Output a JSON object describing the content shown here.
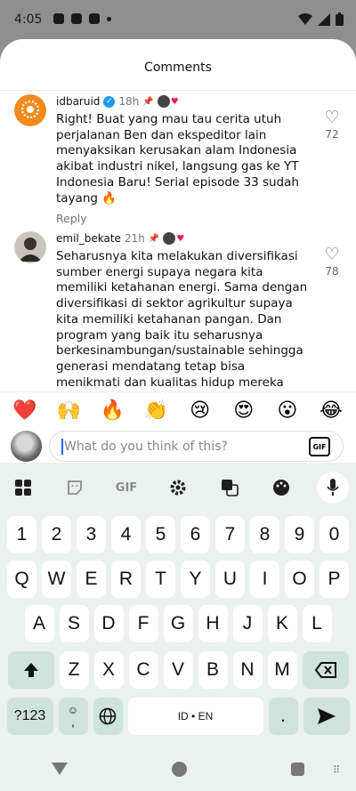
{
  "status": {
    "time": "4:05"
  },
  "sheet": {
    "title": "Comments"
  },
  "comments": [
    {
      "username": "idbaruid",
      "time": "18h",
      "text": "Right! Buat yang mau tau cerita utuh perjalanan Ben dan ekspeditor lain menyaksikan kerusakan alam Indonesia akibat industri nikel, langsung gas ke YT Indonesia Baru! Serial episode 33 sudah tayang 🔥",
      "reply": "Reply",
      "likes": "72"
    },
    {
      "username": "emil_bekate",
      "time": "21h",
      "text": "Seharusnya kita melakukan diversifikasi sumber energi supaya negara kita memiliki ketahanan energi. Sama dengan diversifikasi di sektor agrikultur supaya kita memiliki ketahanan pangan. Dan program yang baik itu seharusnya berkesinambungan/sustainable sehingga generasi mendatang tetap bisa menikmati dan kualitas hidup mereka tidak menurun akibat kebijakan pemerintah saat ini. Apalagi dicaat dunia yang sekarang ini",
      "likes": "78"
    }
  ],
  "emojis": [
    "❤️",
    "🙌",
    "🔥",
    "👏",
    "😢",
    "😍",
    "😮",
    "😂"
  ],
  "input": {
    "placeholder": "What do you think of this?",
    "gif_label": "GIF"
  },
  "keyboard": {
    "toolbar_gif": "GIF",
    "row_numbers": [
      "1",
      "2",
      "3",
      "4",
      "5",
      "6",
      "7",
      "8",
      "9",
      "0"
    ],
    "row1": [
      "Q",
      "W",
      "E",
      "R",
      "T",
      "Y",
      "U",
      "I",
      "O",
      "P"
    ],
    "row2": [
      "A",
      "S",
      "D",
      "F",
      "G",
      "H",
      "J",
      "K",
      "L"
    ],
    "row3": [
      "Z",
      "X",
      "C",
      "V",
      "B",
      "N",
      "M"
    ],
    "symbols_label": "?123",
    "comma": ",",
    "space_label": "ID • EN",
    "period": "."
  }
}
